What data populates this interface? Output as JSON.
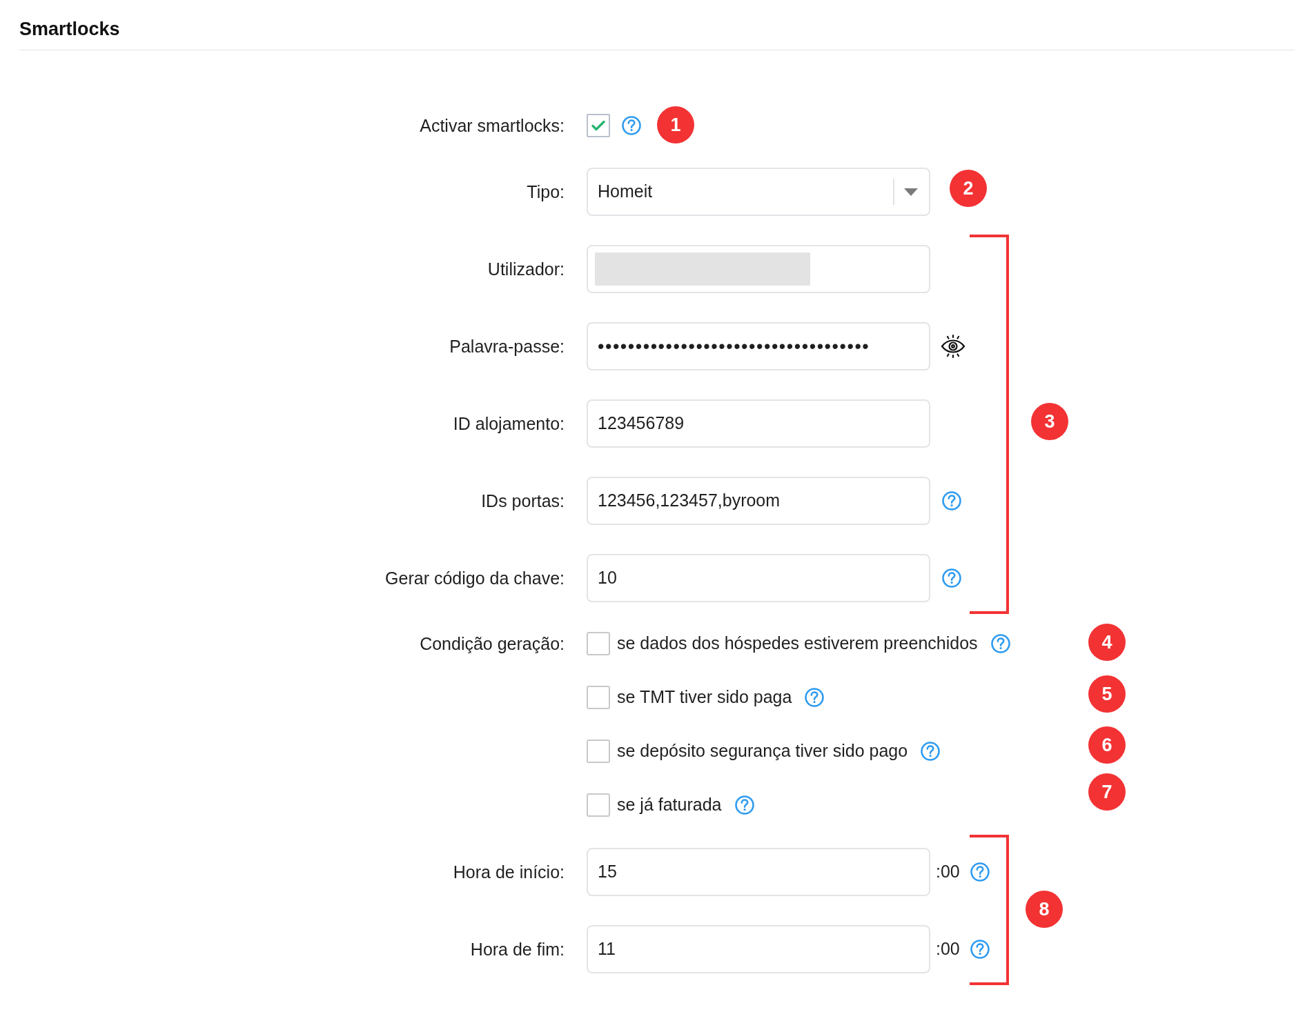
{
  "title": "Smartlocks",
  "fields": [
    {
      "kind": "checkbox",
      "label": "Activar smartlocks:",
      "checked": true,
      "help": true
    },
    {
      "kind": "select",
      "label": "Tipo:",
      "value": "Homeit"
    },
    {
      "kind": "text",
      "label": "Utilizador:",
      "redacted": true
    },
    {
      "kind": "password",
      "label": "Palavra-passe:",
      "value": "••••••••••••••••••••••••••••••••••••"
    },
    {
      "kind": "text",
      "label": "ID alojamento:",
      "value": "123456789"
    },
    {
      "kind": "text",
      "label": "IDs portas:",
      "value": "123456,123457,byroom",
      "help": true
    },
    {
      "kind": "text",
      "label": "Gerar código da chave:",
      "value": "10",
      "help": true
    },
    {
      "kind": "conditions",
      "label": "Condição geração:",
      "options": [
        {
          "label": "se dados dos hóspedes estiverem preenchidos",
          "checked": false,
          "help": true
        },
        {
          "label": "se TMT tiver sido paga",
          "checked": false,
          "help": true
        },
        {
          "label": "se depósito segurança tiver sido pago",
          "checked": false,
          "help": true
        },
        {
          "label": "se já faturada",
          "checked": false,
          "help": true
        }
      ]
    },
    {
      "kind": "text",
      "label": "Hora de início:",
      "value": "15",
      "suffix": ":00",
      "help": true
    },
    {
      "kind": "text",
      "label": "Hora de fim:",
      "value": "11",
      "suffix": ":00",
      "help": true
    }
  ],
  "annotations": [
    {
      "kind": "badge",
      "label": "1"
    },
    {
      "kind": "badge",
      "label": "2"
    },
    {
      "kind": "bracket"
    },
    {
      "kind": "badge",
      "label": "3"
    },
    {
      "kind": "badge",
      "label": "4"
    },
    {
      "kind": "badge",
      "label": "5"
    },
    {
      "kind": "badge",
      "label": "6"
    },
    {
      "kind": "badge",
      "label": "7"
    },
    {
      "kind": "bracket"
    },
    {
      "kind": "badge",
      "label": "8"
    }
  ]
}
